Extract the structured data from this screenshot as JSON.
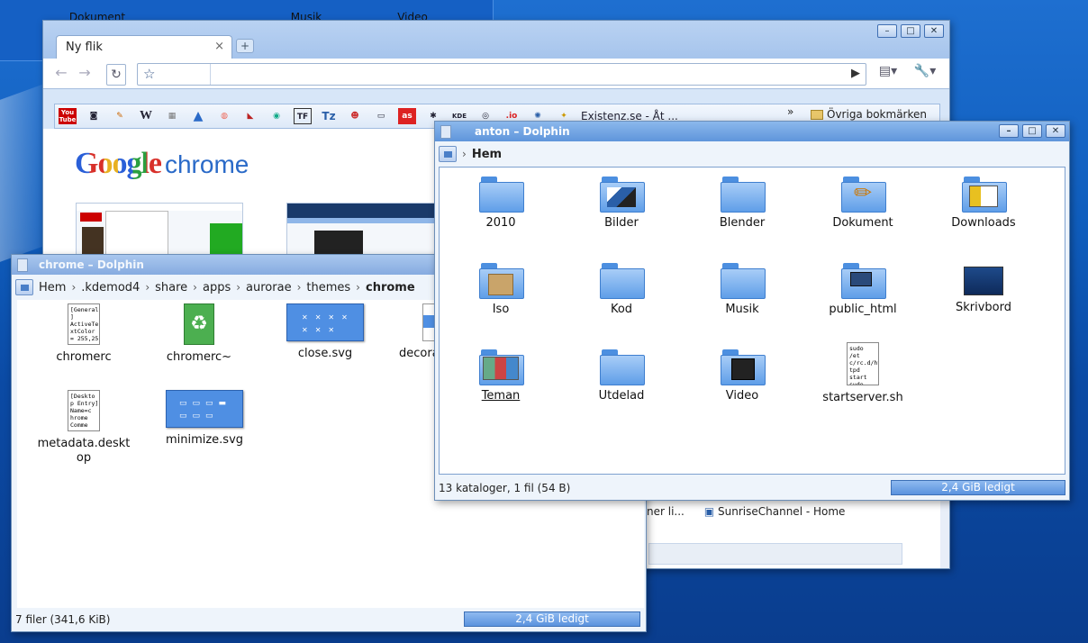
{
  "desktop": {
    "icons": [
      "Dokument",
      "Musik",
      "Video"
    ]
  },
  "chrome": {
    "tab_title": "Ny flik",
    "tab_close": "×",
    "new_tab": "+",
    "bookmarks": [
      "You Tube",
      "W",
      "TF",
      "Tz",
      "KDE",
      ".io"
    ],
    "bookmark_text": "Existenz.se - Åt ...",
    "bookmark_overflow": "»",
    "other_bookmarks": "Övriga bokmärken",
    "logo_google": "Google",
    "logo_chrome": "chrome",
    "behind_text": "SunriseChannel - Home",
    "behind_text_left": "ner li..."
  },
  "dolphin_chrome": {
    "title": "chrome – Dolphin",
    "breadcrumb": [
      "Hem",
      ".kdemod4",
      "share",
      "apps",
      "aurorae",
      "themes",
      "chrome"
    ],
    "items": [
      {
        "label": "chromerc",
        "preview": "[General\n]\nActiveTe\nxtColor\n= 255,25"
      },
      {
        "label": "chromerc~",
        "preview": ""
      },
      {
        "label": "close.svg",
        "preview": ""
      },
      {
        "label": "decora",
        "preview": ""
      },
      {
        "label": "metadata.desktop",
        "preview": "[Deskto\np Entry]\nName=c\nhrome\nComme"
      },
      {
        "label": "minimize.svg",
        "preview": ""
      }
    ],
    "status": "7 filer (341,6 KiB)",
    "free": "2,4 GiB ledigt"
  },
  "dolphin_anton": {
    "title": "anton – Dolphin",
    "breadcrumb": [
      "Hem"
    ],
    "items": [
      {
        "label": "2010"
      },
      {
        "label": "Bilder"
      },
      {
        "label": "Blender"
      },
      {
        "label": "Dokument"
      },
      {
        "label": "Downloads"
      },
      {
        "label": "Iso"
      },
      {
        "label": "Kod"
      },
      {
        "label": "Musik"
      },
      {
        "label": "public_html"
      },
      {
        "label": "Skrivbord"
      },
      {
        "label": "Teman"
      },
      {
        "label": "Utdelad"
      },
      {
        "label": "Video"
      },
      {
        "label": "startserver.sh",
        "preview": "sudo /et\nc/rc.d/ht\ntpd start\nsudo /et\nc/rc.d/m"
      }
    ],
    "status": "13 kataloger, 1 fil (54 B)",
    "free": "2,4 GiB ledigt"
  },
  "window_buttons": {
    "minimize": "–",
    "maximize": "□",
    "close": "✕"
  }
}
